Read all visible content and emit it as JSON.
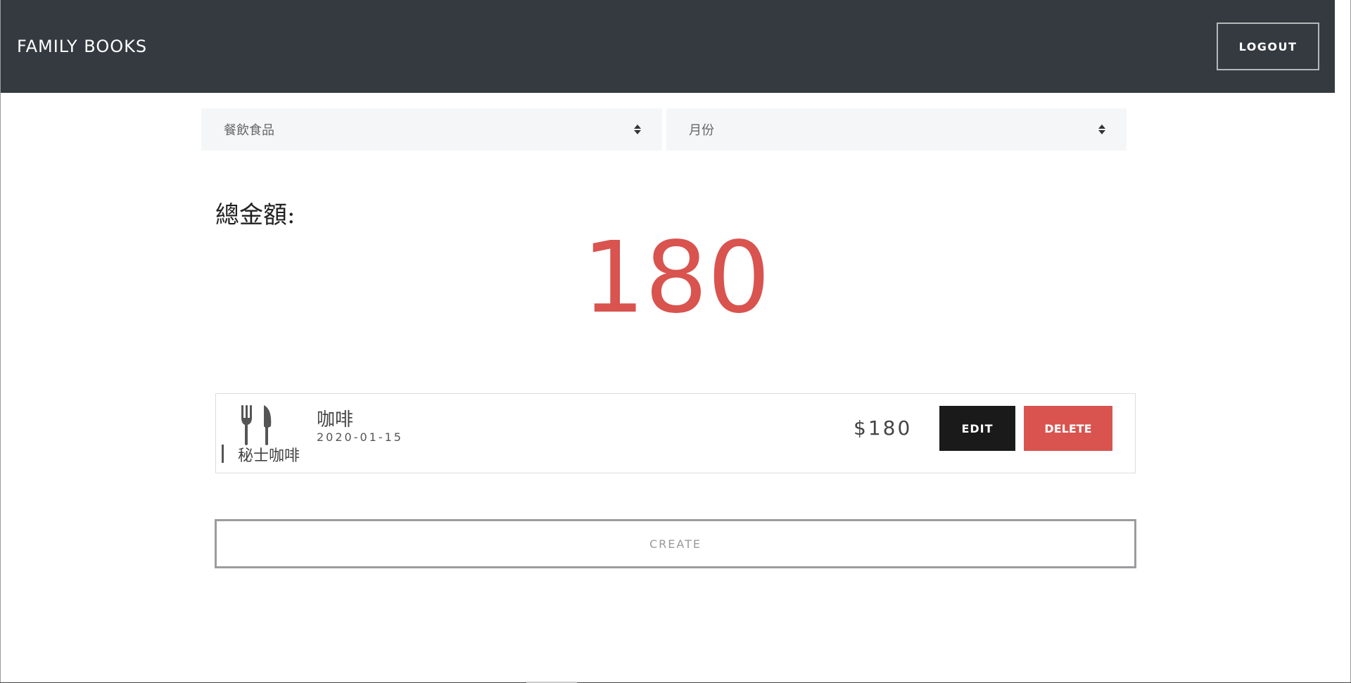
{
  "navbar": {
    "brand": "FAMILY BOOKS",
    "logout_label": "LOGOUT"
  },
  "filters": {
    "category": {
      "selected": "餐飲食品"
    },
    "month": {
      "selected": "月份"
    }
  },
  "summary": {
    "label": "總金額:",
    "value": "180",
    "value_color": "#d9534f"
  },
  "records": [
    {
      "icon": "utensils-icon",
      "title": "咖啡",
      "date": "2020-01-15",
      "shop": "秘士咖啡",
      "amount": "$180",
      "edit_label": "EDIT",
      "delete_label": "DELETE"
    }
  ],
  "create_label": "CREATE",
  "colors": {
    "navbar": "#343a40",
    "danger": "#d9534f",
    "dark": "#1a1a1a"
  }
}
